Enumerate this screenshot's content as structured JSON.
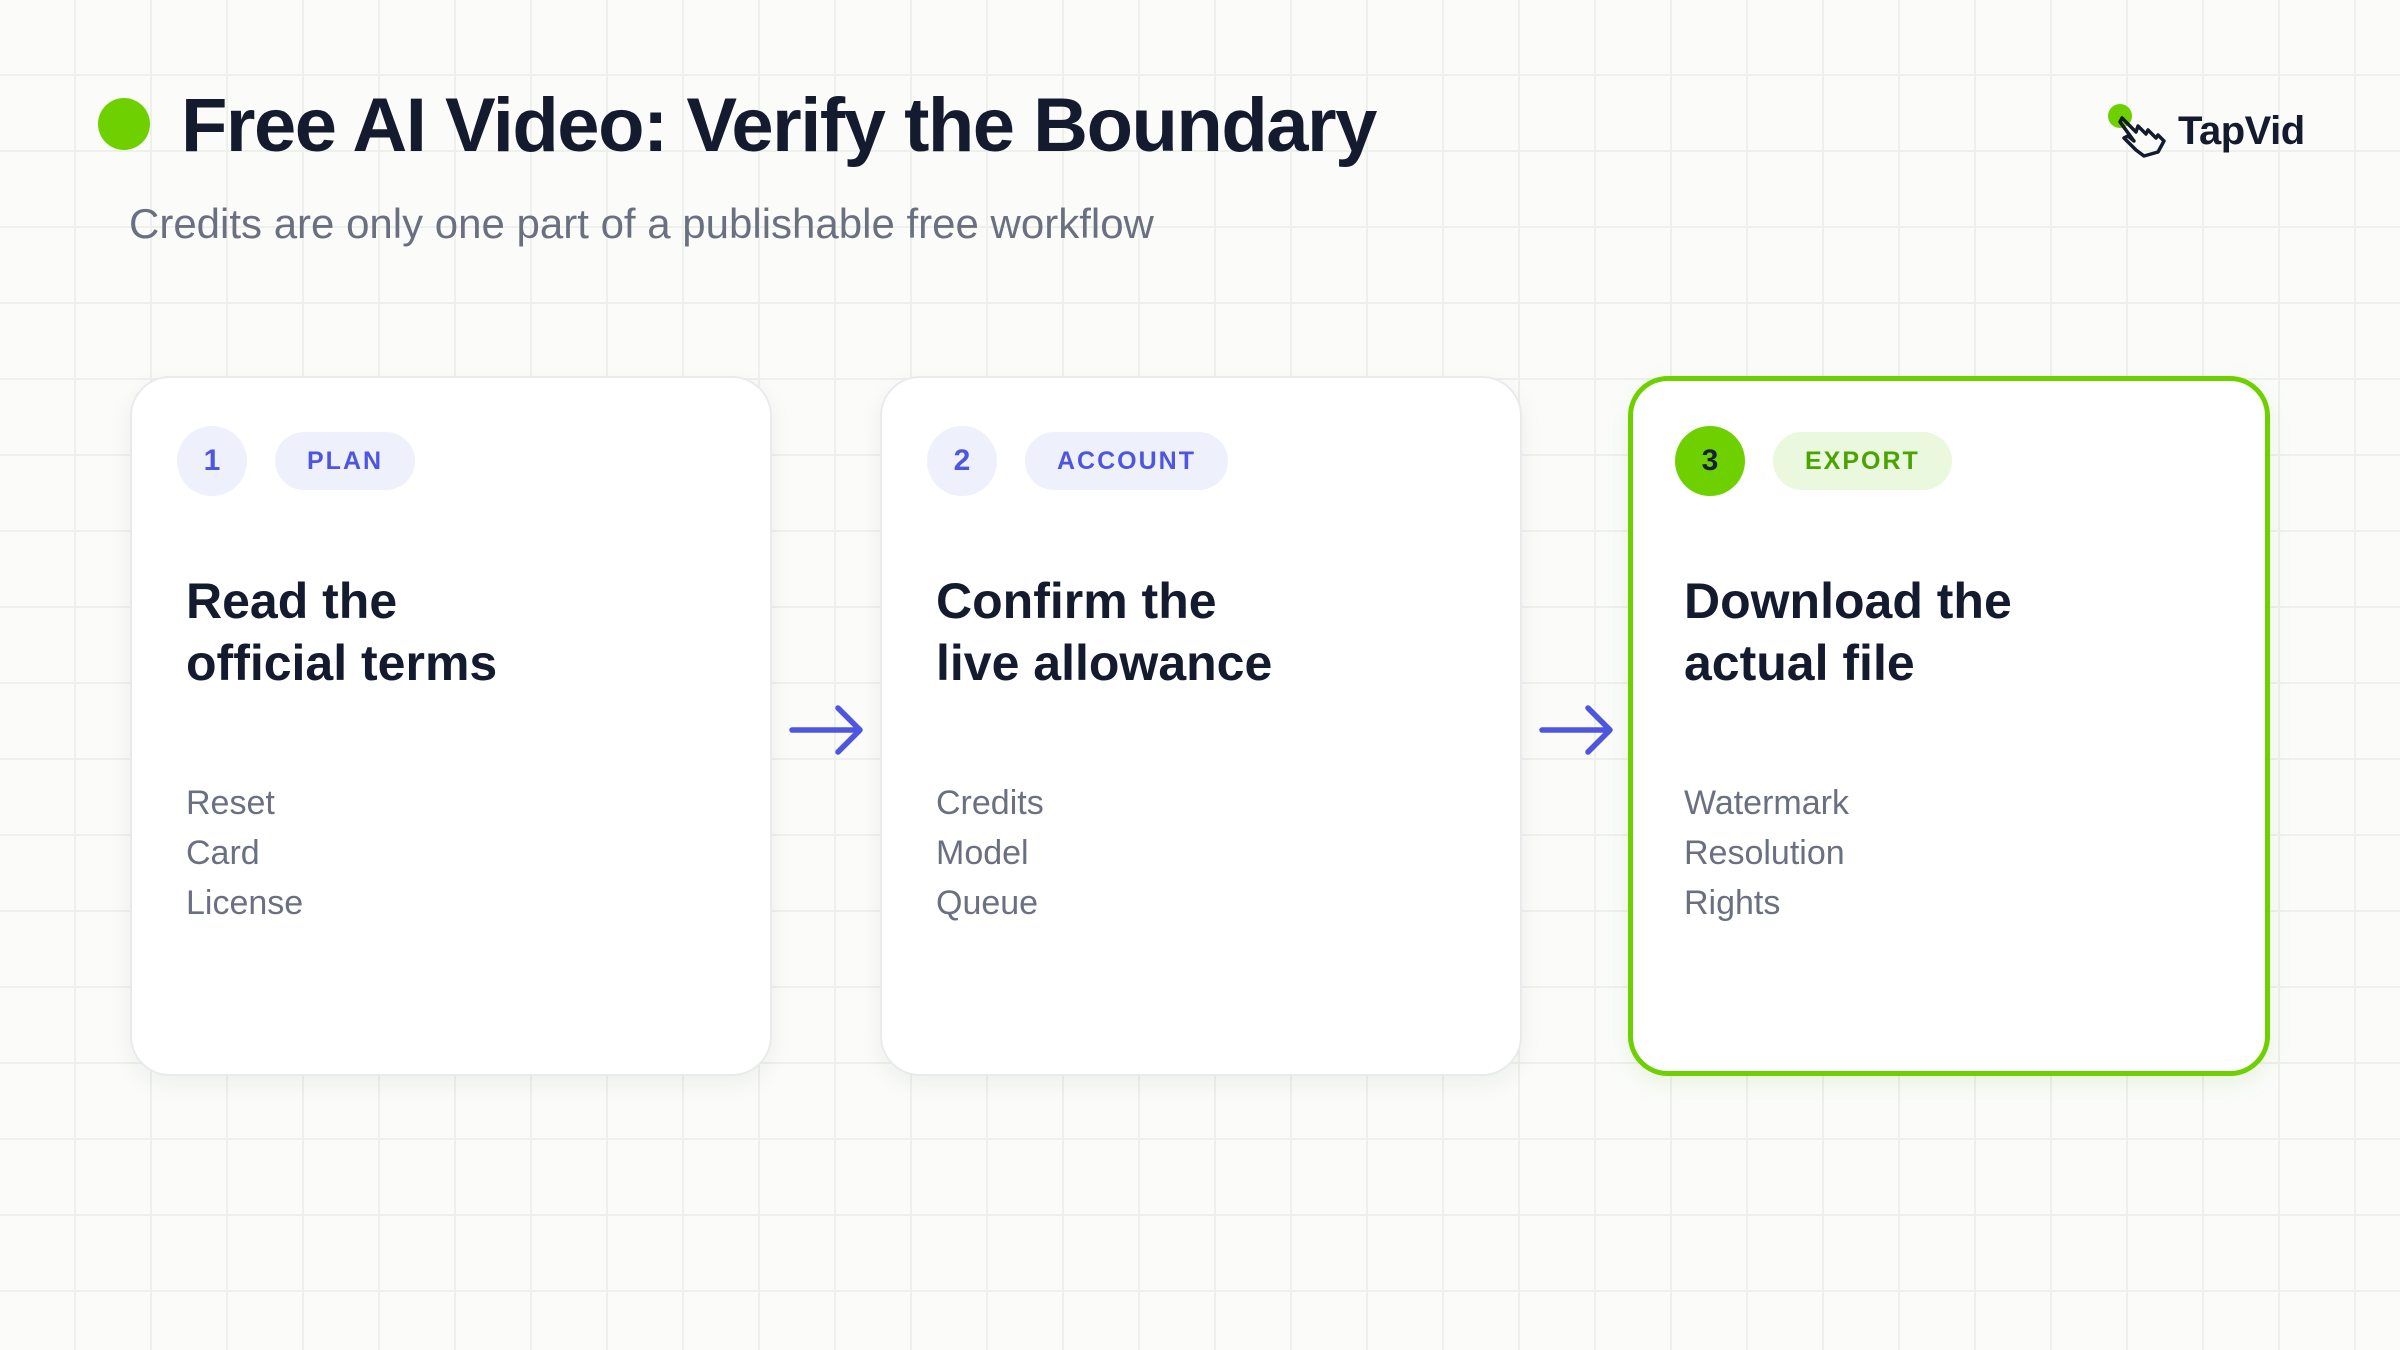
{
  "header": {
    "title": "Free AI Video: Verify the Boundary",
    "subtitle": "Credits are only one part of a publishable free workflow"
  },
  "brand": {
    "name": "TapVid",
    "icon": "hand-pointer-icon"
  },
  "colors": {
    "accent_green": "#6fd000",
    "accent_indigo": "#4e56e0",
    "text_dark": "#151b2e",
    "text_muted": "#6a7080"
  },
  "steps": [
    {
      "number": "1",
      "tag": "PLAN",
      "heading_lines": [
        "Read the",
        "official terms"
      ],
      "items": [
        "Reset",
        "Card",
        "License"
      ],
      "highlighted": false
    },
    {
      "number": "2",
      "tag": "ACCOUNT",
      "heading_lines": [
        "Confirm the",
        "live allowance"
      ],
      "items": [
        "Credits",
        "Model",
        "Queue"
      ],
      "highlighted": false
    },
    {
      "number": "3",
      "tag": "EXPORT",
      "heading_lines": [
        "Download the",
        "actual file"
      ],
      "items": [
        "Watermark",
        "Resolution",
        "Rights"
      ],
      "highlighted": true
    }
  ]
}
